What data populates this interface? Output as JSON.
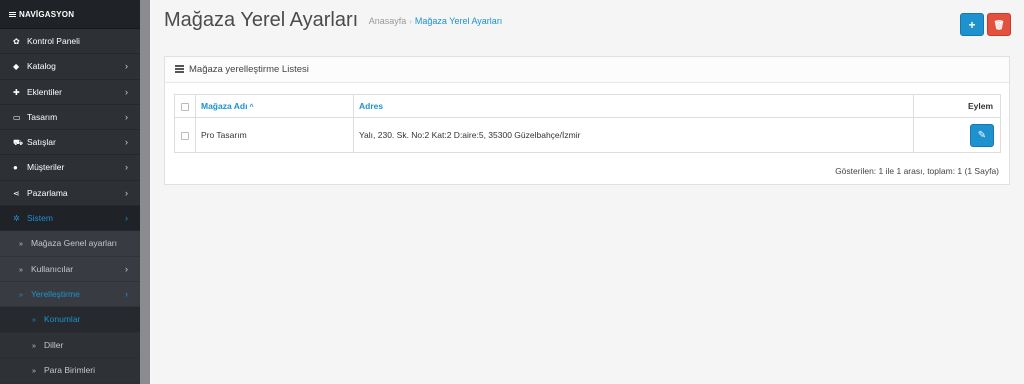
{
  "nav": {
    "title": "NAVİGASYON",
    "items": [
      {
        "label": "Kontrol Paneli",
        "icon": "dashboard-icon",
        "glyph": "✿",
        "chevron": ""
      },
      {
        "label": "Katalog",
        "icon": "tag-icon",
        "glyph": "◆",
        "chevron": "›"
      },
      {
        "label": "Eklentiler",
        "icon": "puzzle-icon",
        "glyph": "✚",
        "chevron": "›"
      },
      {
        "label": "Tasarım",
        "icon": "monitor-icon",
        "glyph": "▭",
        "chevron": "›"
      },
      {
        "label": "Satışlar",
        "icon": "cart-icon",
        "glyph": "⛟",
        "chevron": "›"
      },
      {
        "label": "Müşteriler",
        "icon": "user-icon",
        "glyph": "●",
        "chevron": "›"
      },
      {
        "label": "Pazarlama",
        "icon": "share-icon",
        "glyph": "⋖",
        "chevron": "›"
      },
      {
        "label": "Sistem",
        "icon": "gear-icon",
        "glyph": "✲",
        "chevron": "›"
      }
    ],
    "system_sub": [
      {
        "label": "Mağaza Genel ayarları",
        "chevron": ""
      },
      {
        "label": "Kullanıcılar",
        "chevron": "›"
      },
      {
        "label": "Yerelleştirme",
        "chevron": "›"
      }
    ],
    "localization_sub": [
      {
        "label": "Konumlar"
      },
      {
        "label": "Diller"
      },
      {
        "label": "Para Birimleri"
      }
    ],
    "sub_glyph": "»"
  },
  "header": {
    "title": "Mağaza Yerel Ayarları",
    "breadcrumb": [
      "Anasayfa",
      "Mağaza Yerel Ayarları"
    ],
    "breadcrumb_sep": "›",
    "add_glyph": "+",
    "delete_glyph": "🗑"
  },
  "panel": {
    "title": "Mağaza yerelleştirme Listesi",
    "columns": {
      "name": "Mağaza Adı",
      "address": "Adres",
      "action": "Eylem"
    },
    "sort_glyph": "^",
    "rows": [
      {
        "name": "Pro Tasarım",
        "address": "Yalı, 230. Sk. No:2 Kat:2 D:aire:5, 35300 Güzelbahçe/İzmir"
      }
    ],
    "edit_glyph": "✎",
    "pager": "Gösterilen: 1 ile 1 arası, toplam: 1 (1 Sayfa)"
  },
  "colors": {
    "accent": "#1e91cf",
    "danger": "#e3503e",
    "sidebar": "#2d3035"
  }
}
